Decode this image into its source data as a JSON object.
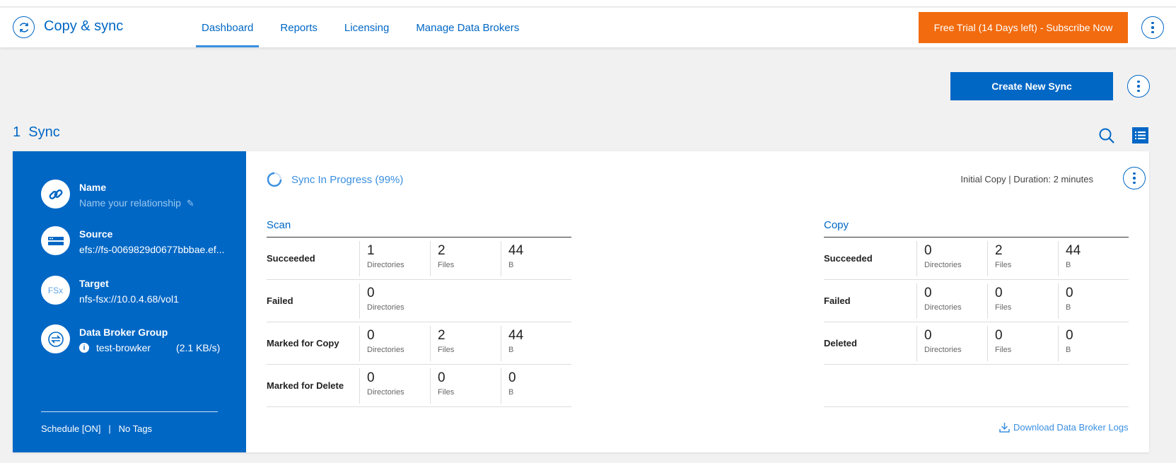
{
  "header": {
    "app_title": "Copy & sync",
    "tabs": [
      "Dashboard",
      "Reports",
      "Licensing",
      "Manage Data Brokers"
    ],
    "trial_label": "Free Trial (14 Days left) - Subscribe Now"
  },
  "toolbar": {
    "create_label": "Create New Sync"
  },
  "sync_count": "1  Sync",
  "card": {
    "sidebar": {
      "name_label": "Name",
      "name_value": "Name your relationship",
      "source_label": "Source",
      "source_value": "efs://fs-0069829d0677bbbae.ef...",
      "target_label": "Target",
      "target_value": "nfs-fsx://10.0.4.68/vol1",
      "target_icon_text": "FSx",
      "broker_label": "Data Broker Group",
      "broker_value": "test-browker",
      "broker_speed": "(2.1 KB/s)",
      "footer": "Schedule [ON]   |   No Tags"
    },
    "status": "Sync In Progress (99%)",
    "duration": "Initial Copy | Duration: 2 minutes",
    "scan": {
      "title": "Scan",
      "rows": [
        {
          "label": "Succeeded",
          "cells": [
            [
              "1",
              "Directories"
            ],
            [
              "2",
              "Files"
            ],
            [
              "44",
              "B"
            ]
          ]
        },
        {
          "label": "Failed",
          "cells": [
            [
              "0",
              "Directories"
            ]
          ]
        },
        {
          "label": "Marked for Copy",
          "cells": [
            [
              "0",
              "Directories"
            ],
            [
              "2",
              "Files"
            ],
            [
              "44",
              "B"
            ]
          ]
        },
        {
          "label": "Marked for Delete",
          "cells": [
            [
              "0",
              "Directories"
            ],
            [
              "0",
              "Files"
            ],
            [
              "0",
              "B"
            ]
          ]
        }
      ]
    },
    "copy": {
      "title": "Copy",
      "rows": [
        {
          "label": "Succeeded",
          "cells": [
            [
              "0",
              "Directories"
            ],
            [
              "2",
              "Files"
            ],
            [
              "44",
              "B"
            ]
          ]
        },
        {
          "label": "Failed",
          "cells": [
            [
              "0",
              "Directories"
            ],
            [
              "0",
              "Files"
            ],
            [
              "0",
              "B"
            ]
          ]
        },
        {
          "label": "Deleted",
          "cells": [
            [
              "0",
              "Directories"
            ],
            [
              "0",
              "Files"
            ],
            [
              "0",
              "B"
            ]
          ]
        }
      ]
    },
    "download_label": "Download Data Broker Logs"
  }
}
